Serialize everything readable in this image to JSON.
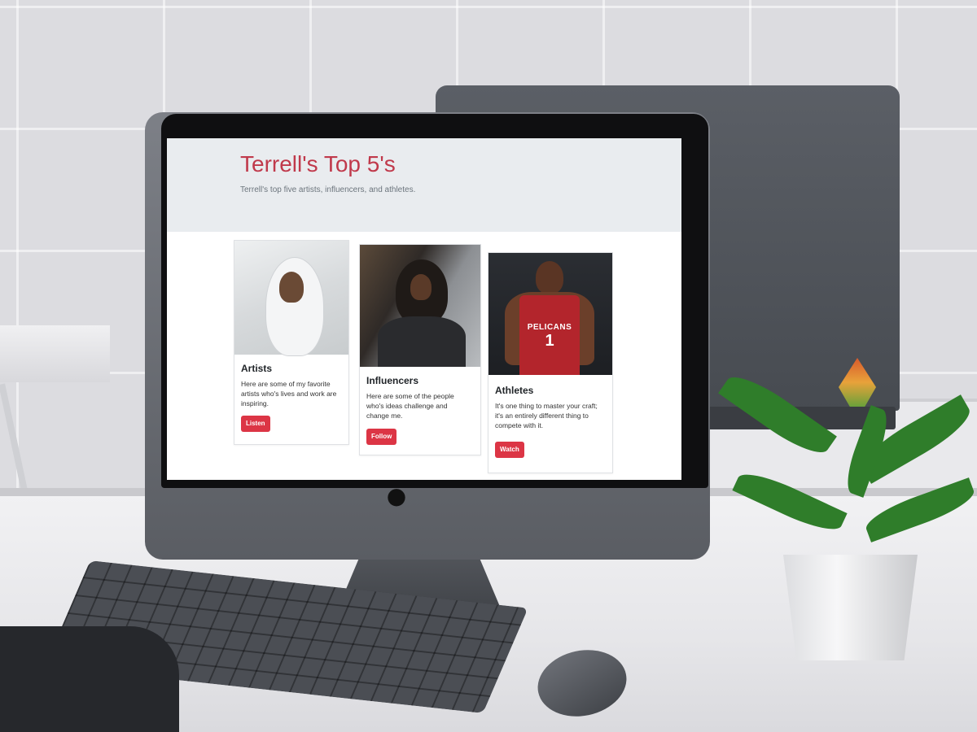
{
  "site": {
    "title": "Terrell's Top 5's",
    "subtitle": "Terrell's top five artists, influencers, and athletes."
  },
  "cards": [
    {
      "title": "Artists",
      "text": "Here are some of my favorite artists who's lives and work are inspiring.",
      "button": "Listen"
    },
    {
      "title": "Influencers",
      "text": "Here are some of the people who's ideas challenge and change me.",
      "button": "Follow"
    },
    {
      "title": "Athletes",
      "text": "It's one thing to master your craft; it's an entirely different thing to compete with it.",
      "button": "Watch"
    }
  ],
  "jersey": {
    "team": "PELICANS",
    "number": "1"
  },
  "colors": {
    "accent": "#dc3545",
    "title": "#c0394b",
    "jumbotron": "#e9ecef",
    "jersey": "#b3252c"
  },
  "icons": {
    "monitor_logo": "apple-logo-icon"
  }
}
